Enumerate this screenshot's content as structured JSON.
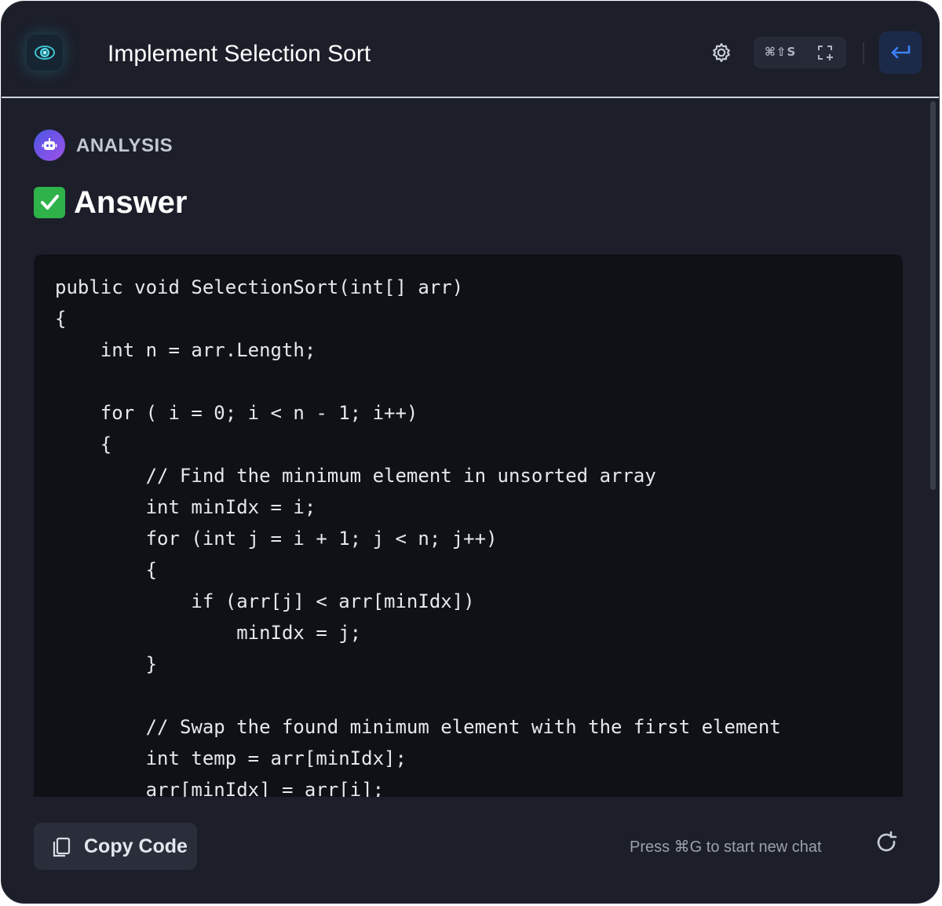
{
  "app": {
    "title": "Implement Selection Sort",
    "logo": "eye-logo-icon",
    "accent": "#3b82f6"
  },
  "toolbar": {
    "settings_icon": "gear-icon",
    "shortcut": "⌘⇧S",
    "expand_icon": "expand-icon",
    "return_icon": "return-arrow-icon"
  },
  "message": {
    "section_label": "ANALYSIS",
    "bot_icon": "robot-icon",
    "answer_badge": "check-mark-icon",
    "answer_heading": "Answer",
    "code": "public void SelectionSort(int[] arr)\n{\n    int n = arr.Length;\n\n    for ( i = 0; i < n - 1; i++)\n    {\n        // Find the minimum element in unsorted array\n        int minIdx = i;\n        for (int j = i + 1; j < n; j++)\n        {\n            if (arr[j] < arr[minIdx])\n                minIdx = j;\n        }\n\n        // Swap the found minimum element with the first element\n        int temp = arr[minIdx];\n        arr[minIdx] = arr[i];"
  },
  "footer": {
    "copy_label": "Copy Code",
    "copy_icon": "copy-icon",
    "hint": "Press ⌘G to start new chat",
    "refresh_icon": "refresh-icon"
  }
}
